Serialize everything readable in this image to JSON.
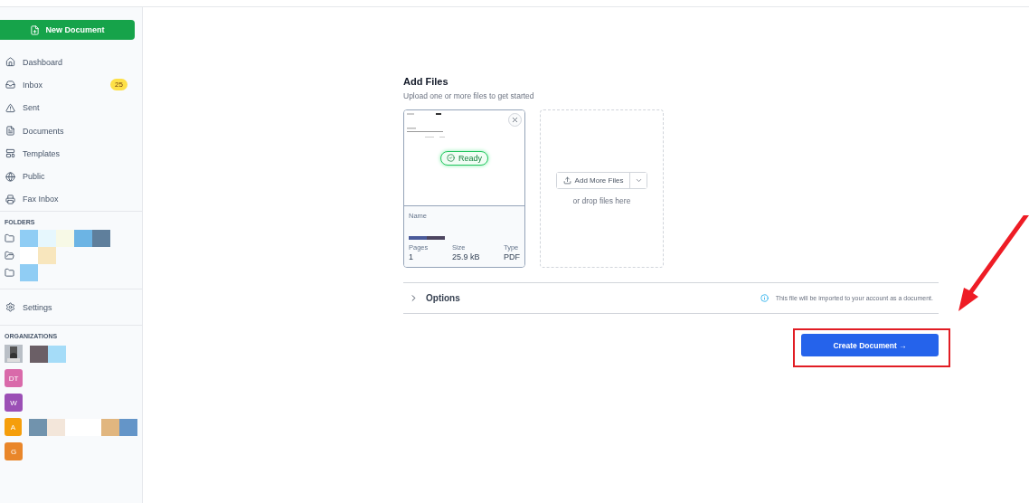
{
  "sidebar": {
    "new_button": "New Document",
    "nav": [
      {
        "label": "Dashboard"
      },
      {
        "label": "Inbox",
        "badge": "25"
      },
      {
        "label": "Sent"
      },
      {
        "label": "Documents"
      },
      {
        "label": "Templates"
      },
      {
        "label": "Public"
      },
      {
        "label": "Fax Inbox"
      }
    ],
    "folders_heading": "FOLDERS",
    "folders": [
      {
        "kind": "folder"
      },
      {
        "kind": "shared"
      },
      {
        "kind": "folder"
      }
    ],
    "settings": "Settings",
    "organizations_heading": "ORGANIZATIONS",
    "organizations": [
      {
        "kind": "picture"
      },
      {
        "kind": "initials",
        "initials": "DT",
        "color": "#d96aaa"
      },
      {
        "kind": "initials",
        "initials": "W",
        "color": "#9b4fb5"
      },
      {
        "kind": "initials",
        "initials": "A",
        "color": "#f59e0b"
      },
      {
        "kind": "initials",
        "initials": "G",
        "color": "#e9862a"
      }
    ]
  },
  "upload": {
    "title": "Add Files",
    "subtitle": "Upload one or more files to get started",
    "file": {
      "status": "Ready",
      "name_label": "Name",
      "pages_label": "Pages",
      "pages": "1",
      "size_label": "Size",
      "size": "25.9 kB",
      "type_label": "Type",
      "type": "PDF"
    },
    "add_more": "Add More Files",
    "drop_hint": "or drop files here"
  },
  "options": {
    "label": "Options",
    "expanded": false,
    "note": "This file will be imported to your account as a document."
  },
  "create_button": "Create Document →"
}
